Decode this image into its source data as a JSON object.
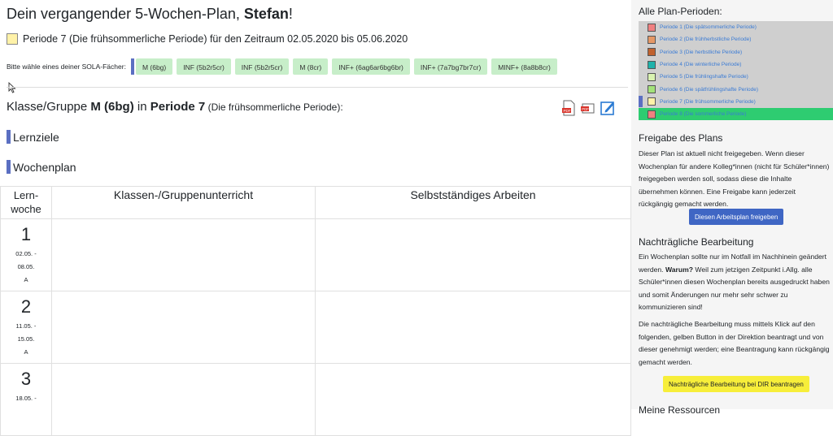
{
  "header": {
    "title_prefix": "Dein vergangender 5-Wochen-Plan, ",
    "user_name": "Stefan",
    "title_suffix": "!"
  },
  "period": {
    "text": "Periode 7 (Die frühsommerliche Periode) für den Zeitraum 02.05.2020 bis 05.06.2020",
    "color": "#fff2a8"
  },
  "subjects": {
    "label": "Bitte wähle eines deiner SOLA-Fächer:",
    "items": [
      "M (6bg)",
      "INF (5b2r5cr)",
      "INF (5b2r5cr)",
      "M (8cr)",
      "INF+ (6ag6ar6bg6br)",
      "INF+ (7a7bg7br7cr)",
      "MINF+ (8a8b8cr)"
    ]
  },
  "class_heading": {
    "prefix": "Klasse/Gruppe ",
    "group": "M (6bg)",
    "middle": " in ",
    "period": "Periode 7",
    "note": " (Die frühsommerliche Periode):"
  },
  "toolbar": {
    "icons": [
      "pdf-icon",
      "pdf-alt-icon",
      "edit-icon"
    ]
  },
  "sections": {
    "lernziele": "Lernziele",
    "wochenplan": "Wochenplan"
  },
  "table": {
    "col_week_1": "Lern-",
    "col_week_2": "woche",
    "col_class": "Klassen-/Gruppenunterricht",
    "col_self": "Selbstständiges Arbeiten",
    "weeks": [
      {
        "num": "1",
        "from": "02.05. -",
        "to": "08.05.",
        "type": "A"
      },
      {
        "num": "2",
        "from": "11.05. -",
        "to": "15.05.",
        "type": "A"
      },
      {
        "num": "3",
        "from": "18.05. -",
        "to": "",
        "type": ""
      }
    ]
  },
  "sidebar": {
    "periods_title": "Alle Plan-Perioden:",
    "periods": [
      {
        "label": "Periode 1 (Die spätsommerliche Periode)",
        "color": "#f08080"
      },
      {
        "label": "Periode 2 (Die frühherbstliche Periode)",
        "color": "#e59866"
      },
      {
        "label": "Periode 3 (Die herbstliche Periode)",
        "color": "#c0622f"
      },
      {
        "label": "Periode 4 (Die winterliche Periode)",
        "color": "#20b2aa"
      },
      {
        "label": "Periode 5 (Die frühlingshafte Periode)",
        "color": "#d9f2b0"
      },
      {
        "label": "Periode 6 (Die spätfrühlingshafte Periode)",
        "color": "#a3e27a"
      },
      {
        "label": "Periode 7 (Die frühsommerliche Periode)",
        "color": "#fff2a8"
      },
      {
        "label": "Periode 8 (Die sommerliche Periode)",
        "color": "#f08080"
      }
    ],
    "release_title": "Freigabe des Plans",
    "release_text": "Dieser Plan ist aktuell nicht freigegeben. Wenn dieser Wochenplan für andere Kolleg*innen (nicht für Schüler*innen) freigegeben werden soll, sodass diese die Inhalte übernehmen können. Eine Freigabe kann jederzeit rückgängig gemacht werden.",
    "release_button": "Diesen Arbeitsplan freigeben",
    "edit_title": "Nachträgliche Bearbeitung",
    "edit_text_1a": "Ein Wochenplan sollte nur im Notfall im Nachhinein geändert werden. ",
    "edit_text_1b": "Warum?",
    "edit_text_1c": " Weil zum jetzigen Zeitpunkt i.Allg. alle Schüler*innen diesen Wochenplan bereits ausgedruckt haben und somit Änderungen nur mehr sehr schwer zu kommunizieren sind!",
    "edit_text_2": "Die nachträgliche Bearbeitung muss mittels Klick auf den folgenden, gelben Button in der Direktion beantragt und von dieser genehmigt werden; eine Beantragung kann rückgängig gemacht werden.",
    "edit_button": "Nachträgliche Bearbeitung bei DIR beantragen",
    "resources_title": "Meine Ressourcen"
  }
}
